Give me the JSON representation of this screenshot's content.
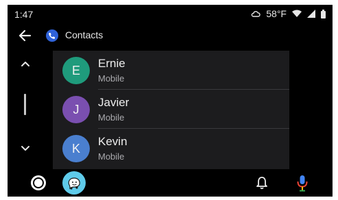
{
  "status": {
    "time": "1:47",
    "weather": "58°F"
  },
  "header": {
    "title": "Contacts"
  },
  "contacts": [
    {
      "initial": "E",
      "name": "Ernie",
      "type": "Mobile",
      "color": "#1f9b7c"
    },
    {
      "initial": "J",
      "name": "Javier",
      "type": "Mobile",
      "color": "#7a4fb0"
    },
    {
      "initial": "K",
      "name": "Kevin",
      "type": "Mobile",
      "color": "#4a7fcf"
    }
  ],
  "icons": {
    "back": "back-arrow-icon",
    "app": "phone-app-icon",
    "weather": "cloud-icon",
    "wifi": "wifi-icon",
    "signal": "signal-icon",
    "battery": "battery-icon",
    "scroll_up": "chevron-up-icon",
    "scroll_down": "chevron-down-icon",
    "home": "home-icon",
    "waze": "waze-icon",
    "notifications": "bell-icon",
    "voice": "mic-icon"
  },
  "colors": {
    "background": "#000000",
    "list_background": "#1c1c1e",
    "accent": "#2f62d8",
    "waze": "#5fcbea"
  }
}
